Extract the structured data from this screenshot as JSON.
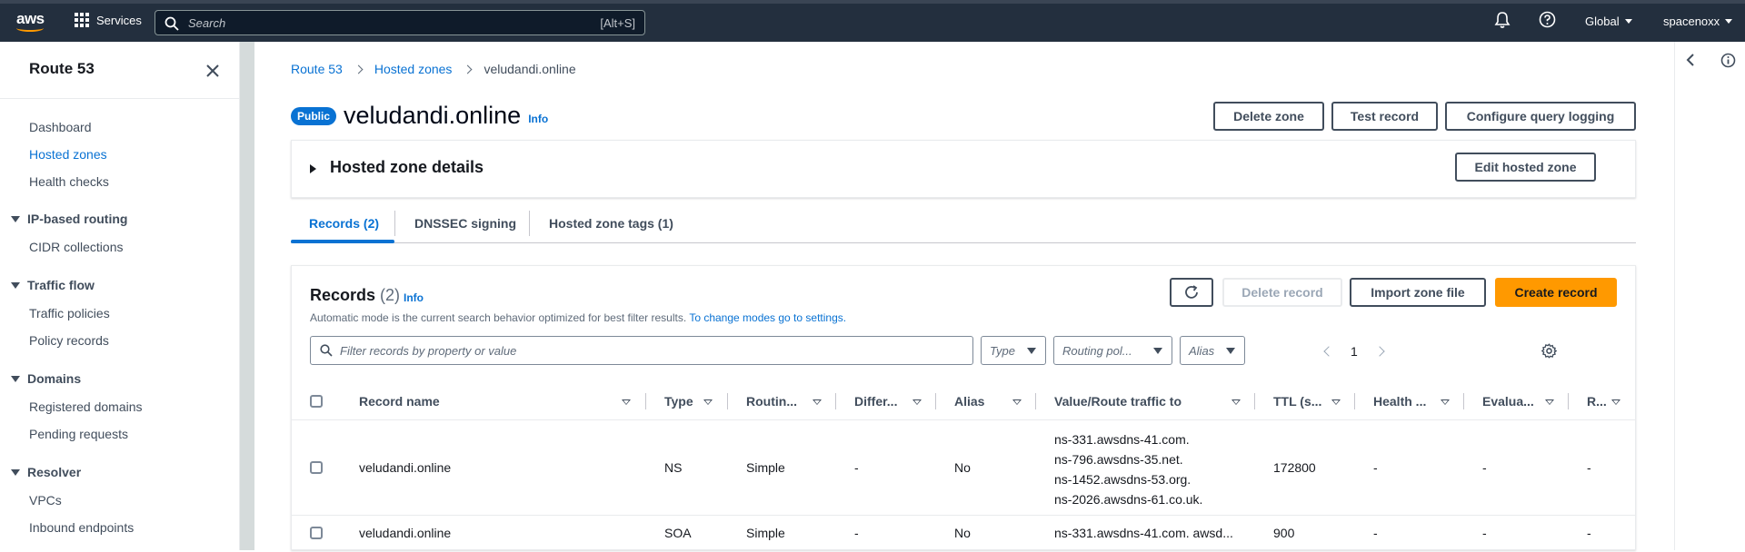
{
  "topbar": {
    "logo_text": "aws",
    "services_label": "Services",
    "search_placeholder": "Search",
    "search_shortcut": "[Alt+S]",
    "region_label": "Global",
    "account_label": "spacenoxx"
  },
  "sidebar": {
    "title": "Route 53",
    "links": [
      "Dashboard",
      "Hosted zones",
      "Health checks"
    ],
    "groups": [
      {
        "label": "IP-based routing",
        "items": [
          "CIDR collections"
        ]
      },
      {
        "label": "Traffic flow",
        "items": [
          "Traffic policies",
          "Policy records"
        ]
      },
      {
        "label": "Domains",
        "items": [
          "Registered domains",
          "Pending requests"
        ]
      },
      {
        "label": "Resolver",
        "items": [
          "VPCs",
          "Inbound endpoints"
        ]
      }
    ]
  },
  "breadcrumb": [
    "Route 53",
    "Hosted zones",
    "veludandi.online"
  ],
  "page": {
    "badge": "Public",
    "title": "veludandi.online",
    "info": "Info",
    "actions": [
      "Delete zone",
      "Test record",
      "Configure query logging"
    ]
  },
  "hosted_zone_panel": {
    "label": "Hosted zone details",
    "edit_button": "Edit hosted zone"
  },
  "tabs": [
    "Records (2)",
    "DNSSEC signing",
    "Hosted zone tags (1)"
  ],
  "records": {
    "title": "Records",
    "count": "(2)",
    "info": "Info",
    "description": "Automatic mode is the current search behavior optimized for best filter results.",
    "settings_link": "To change modes go to settings.",
    "delete_button": "Delete record",
    "import_button": "Import zone file",
    "create_button": "Create record",
    "filter_placeholder": "Filter records by property or value",
    "type_select": "Type",
    "routing_select": "Routing pol...",
    "alias_select": "Alias",
    "page_number": "1",
    "columns": [
      "Record name",
      "Type",
      "Routin...",
      "Differ...",
      "Alias",
      "Value/Route traffic to",
      "TTL (s...",
      "Health ...",
      "Evalua...",
      "R..."
    ],
    "rows": [
      {
        "name": "veludandi.online",
        "type": "NS",
        "routing": "Simple",
        "differ": "-",
        "alias": "No",
        "values": [
          "ns-331.awsdns-41.com.",
          "ns-796.awsdns-35.net.",
          "ns-1452.awsdns-53.org.",
          "ns-2026.awsdns-61.co.uk."
        ],
        "ttl": "172800",
        "health": "-",
        "evaluate": "-",
        "r": "-"
      },
      {
        "name": "veludandi.online",
        "type": "SOA",
        "routing": "Simple",
        "differ": "-",
        "alias": "No",
        "values": [
          "ns-331.awsdns-41.com. awsd..."
        ],
        "ttl": "900",
        "health": "-",
        "evaluate": "-",
        "r": "-"
      }
    ]
  }
}
